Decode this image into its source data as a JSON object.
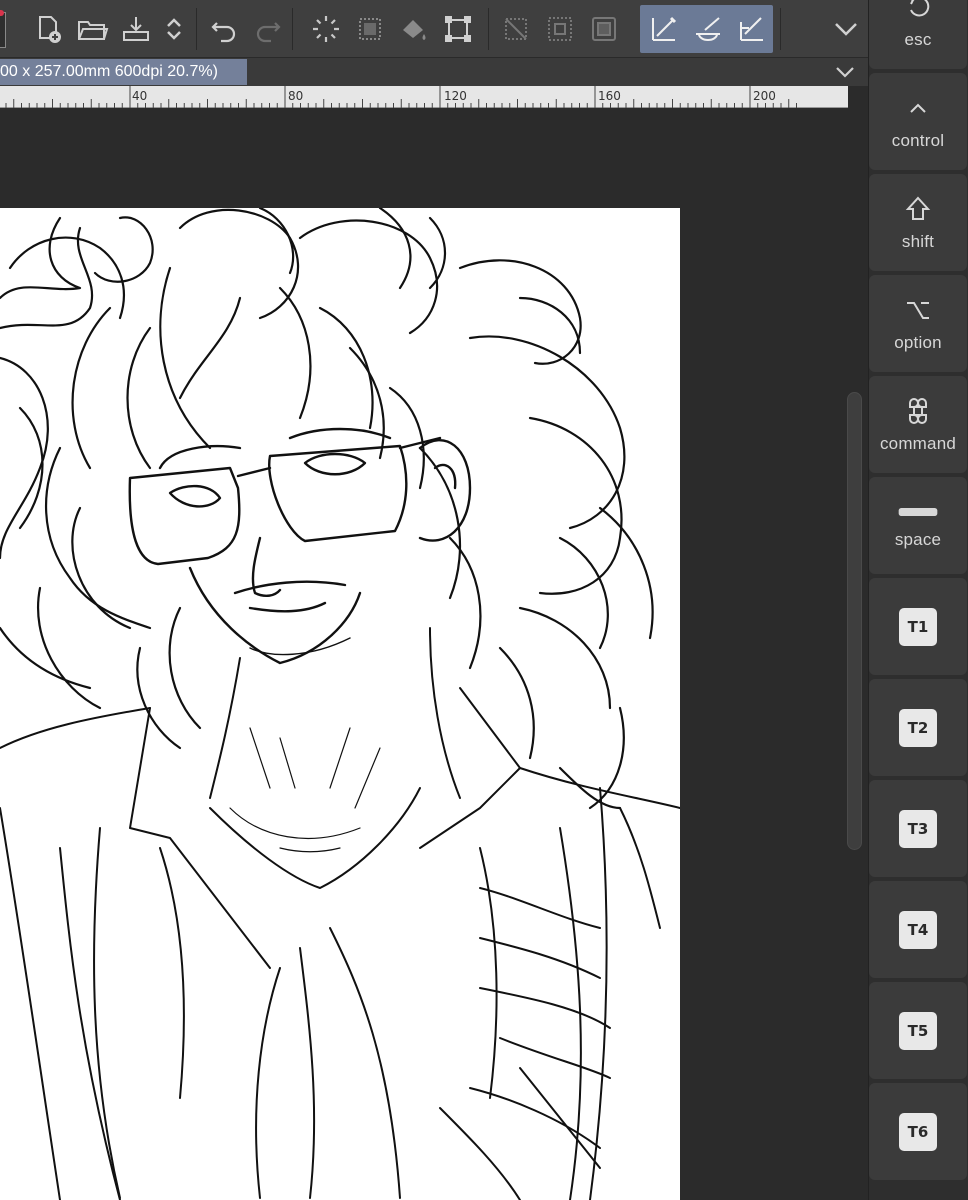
{
  "document": {
    "title": "00 x 257.00mm 600dpi 20.7%)"
  },
  "ruler": {
    "labels": [
      "40",
      "80",
      "120",
      "160",
      "200"
    ]
  },
  "toolbar": {
    "icons": [
      "new-document-icon",
      "open-folder-icon",
      "export-icon",
      "stepper-icon",
      "undo-icon",
      "redo-icon",
      "loading-icon",
      "select-all-icon",
      "fill-icon",
      "transform-icon",
      "deselect-icon",
      "invert-selection-icon",
      "crop-icon",
      "pen-ruler-icon",
      "brush-ruler-icon",
      "straight-ruler-icon",
      "expand-chevron-icon"
    ]
  },
  "keys": [
    {
      "label": "esc",
      "icon": "esc-icon"
    },
    {
      "label": "control",
      "icon": "control-icon"
    },
    {
      "label": "shift",
      "icon": "shift-icon"
    },
    {
      "label": "option",
      "icon": "option-icon"
    },
    {
      "label": "command",
      "icon": "command-icon"
    },
    {
      "label": "space",
      "icon": "space-icon"
    },
    {
      "label": "T1"
    },
    {
      "label": "T2"
    },
    {
      "label": "T3"
    },
    {
      "label": "T4"
    },
    {
      "label": "T5"
    },
    {
      "label": "T6"
    }
  ],
  "colors": {
    "toolbar_bg": "#3f3f3f",
    "active_highlight": "#6b7a96",
    "title_chip": "#74809a",
    "panel_bg": "#2e2e2e",
    "key_bg": "#3b3b3b"
  }
}
